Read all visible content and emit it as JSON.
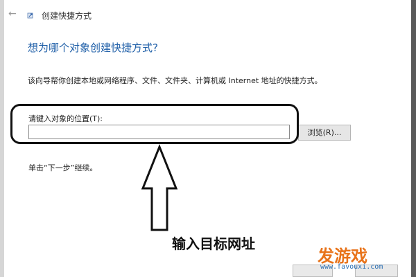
{
  "window": {
    "title": "创建快捷方式",
    "back_glyph": "←"
  },
  "main": {
    "heading": "想为哪个对象创建快捷方式?",
    "description": "该向导帮你创建本地或网络程序、文件、文件夹、计算机或 Internet 地址的快捷方式。",
    "location_label": "请键入对象的位置(T):",
    "location_value": "",
    "browse_label": "浏览(R)...",
    "next_hint": "单击“下一步”继续。"
  },
  "annotation": {
    "text": "输入目标网址"
  },
  "watermark": {
    "brand": "发游戏",
    "url": "www.favouxi.com"
  },
  "colors": {
    "heading": "#1f5fa8",
    "watermark_brand": "#e8731a",
    "watermark_url": "#2a6fb3"
  }
}
